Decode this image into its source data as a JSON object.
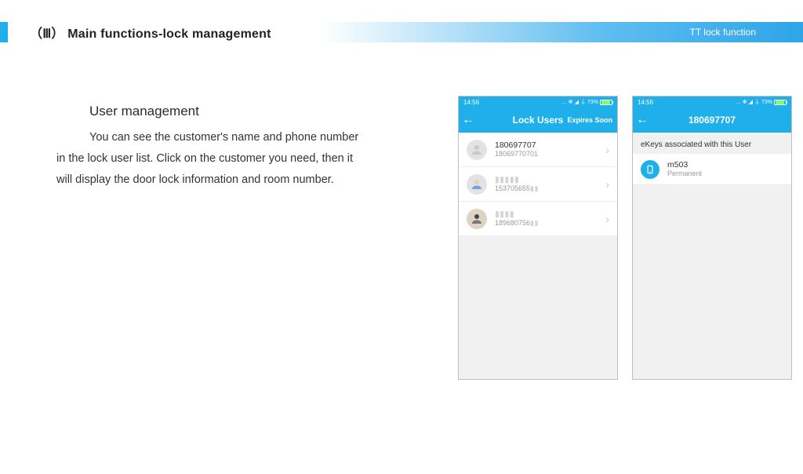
{
  "header": {
    "title": "（Ⅲ） Main functions-lock management",
    "right": "TT lock function"
  },
  "text": {
    "heading": "User management",
    "line1": "You can see the customer's name and phone number",
    "line2": "in the lock user list. Click on the customer you need, then it",
    "line3": "will display the door lock information and room number."
  },
  "status": {
    "time": "14:56",
    "battery": "73%"
  },
  "phone1": {
    "title": "Lock Users",
    "action": "Expires Soon",
    "rows": [
      {
        "name": "180697707",
        "sub": "18069770701"
      },
      {
        "name": "",
        "sub": "153705655"
      },
      {
        "name": "",
        "sub": "189680756"
      }
    ]
  },
  "phone2": {
    "title": "180697707",
    "section": "eKeys associated with this User",
    "ekey": {
      "name": "m503",
      "sub": "Permanent"
    }
  }
}
